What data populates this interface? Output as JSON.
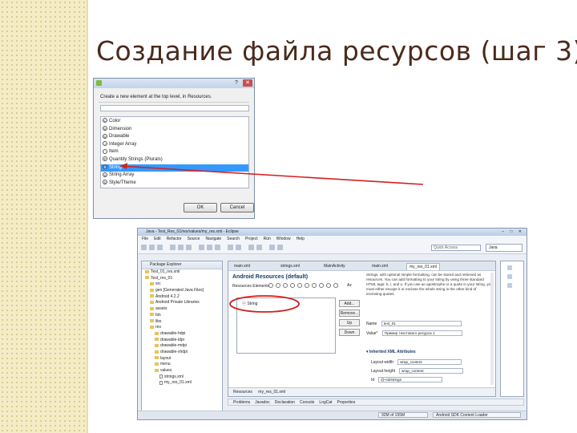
{
  "slide": {
    "title": "Создание файла ресурсов (шаг 3)"
  },
  "dialog": {
    "prompt": "Create a new element at the top level, in Resources.",
    "items": [
      {
        "letter": "C",
        "label": "Color"
      },
      {
        "letter": "D",
        "label": "Dimension"
      },
      {
        "letter": "D",
        "label": "Drawable"
      },
      {
        "letter": "I",
        "label": "Integer Array"
      },
      {
        "letter": "",
        "label": "Item"
      },
      {
        "letter": "P",
        "label": "Quantity Strings (Plurals)"
      },
      {
        "letter": "S",
        "label": "String",
        "selected": true
      },
      {
        "letter": "A",
        "label": "String Array"
      },
      {
        "letter": "S",
        "label": "Style/Theme"
      }
    ],
    "ok_label": "OK",
    "cancel_label": "Cancel"
  },
  "eclipse": {
    "title": "Java - Test_Res_01/res/values/my_res.xml - Eclipse",
    "menu": [
      "File",
      "Edit",
      "Refactor",
      "Source",
      "Navigate",
      "Search",
      "Project",
      "Run",
      "Window",
      "Help"
    ],
    "quick_access": "Quick Access",
    "perspective": "Java",
    "package_explorer": {
      "title": "Package Explorer",
      "rows": [
        {
          "indent": 4,
          "kind": "folder",
          "text": "Test_01_res.xml"
        },
        {
          "indent": 4,
          "kind": "folder",
          "text": "Test_res_01"
        },
        {
          "indent": 10,
          "kind": "folder",
          "text": "src"
        },
        {
          "indent": 10,
          "kind": "folder",
          "text": "gen [Generated Java Files]"
        },
        {
          "indent": 10,
          "kind": "folder",
          "text": "Android 4.2.2"
        },
        {
          "indent": 10,
          "kind": "folder",
          "text": "Android Private Libraries"
        },
        {
          "indent": 10,
          "kind": "folder",
          "text": "assets"
        },
        {
          "indent": 10,
          "kind": "folder",
          "text": "bin"
        },
        {
          "indent": 10,
          "kind": "folder",
          "text": "libs"
        },
        {
          "indent": 10,
          "kind": "folder",
          "text": "res"
        },
        {
          "indent": 16,
          "kind": "folder",
          "text": "drawable-hdpi"
        },
        {
          "indent": 16,
          "kind": "folder",
          "text": "drawable-ldpi"
        },
        {
          "indent": 16,
          "kind": "folder",
          "text": "drawable-mdpi"
        },
        {
          "indent": 16,
          "kind": "folder",
          "text": "drawable-xhdpi"
        },
        {
          "indent": 16,
          "kind": "folder",
          "text": "layout"
        },
        {
          "indent": 16,
          "kind": "folder",
          "text": "menu"
        },
        {
          "indent": 16,
          "kind": "folder",
          "text": "values"
        },
        {
          "indent": 22,
          "kind": "file",
          "text": "strings.xml"
        },
        {
          "indent": 22,
          "kind": "file",
          "text": "my_res_01.xml"
        }
      ]
    },
    "editor": {
      "tabs": [
        "main.xml",
        "strings.xml",
        "MainActivity",
        "main.xml",
        "my_res_01.xml"
      ],
      "title": "Android Resources (default)",
      "resource_elements_label": "Resources Elements",
      "az_label": "Az",
      "list_item": "String",
      "buttons": [
        "Add...",
        "Remove...",
        "Up",
        "Down"
      ],
      "description": "Strings, with optional simple formatting, can be stored and retrieved as resources. You can add formatting to your string by using three standard HTML tags: b, i, and u. If you use an apostrophe or a quote in your string, you must either escape it or enclose the whole string in the other kind of enclosing quotes.",
      "name_label": "Name",
      "name_value": "text_01",
      "value_label": "Value*",
      "value_value": "Пример текстового ресурса 1",
      "inherited_label": "Inherited XML Attributes",
      "attributes": [
        {
          "label": "Layout width",
          "value": "wrap_content"
        },
        {
          "label": "Layout height",
          "value": "wrap_content"
        },
        {
          "label": "Id",
          "value": "@+id/strings"
        }
      ],
      "bottom_tabs": [
        "Resources",
        "my_res_01.xml"
      ]
    },
    "bottom_view_tabs": [
      "Problems",
      "Javadoc",
      "Declaration",
      "Console",
      "LogCat",
      "Properties"
    ],
    "status": {
      "memory": "92M of 155M",
      "sdk": "Android SDK Content Loader"
    }
  }
}
